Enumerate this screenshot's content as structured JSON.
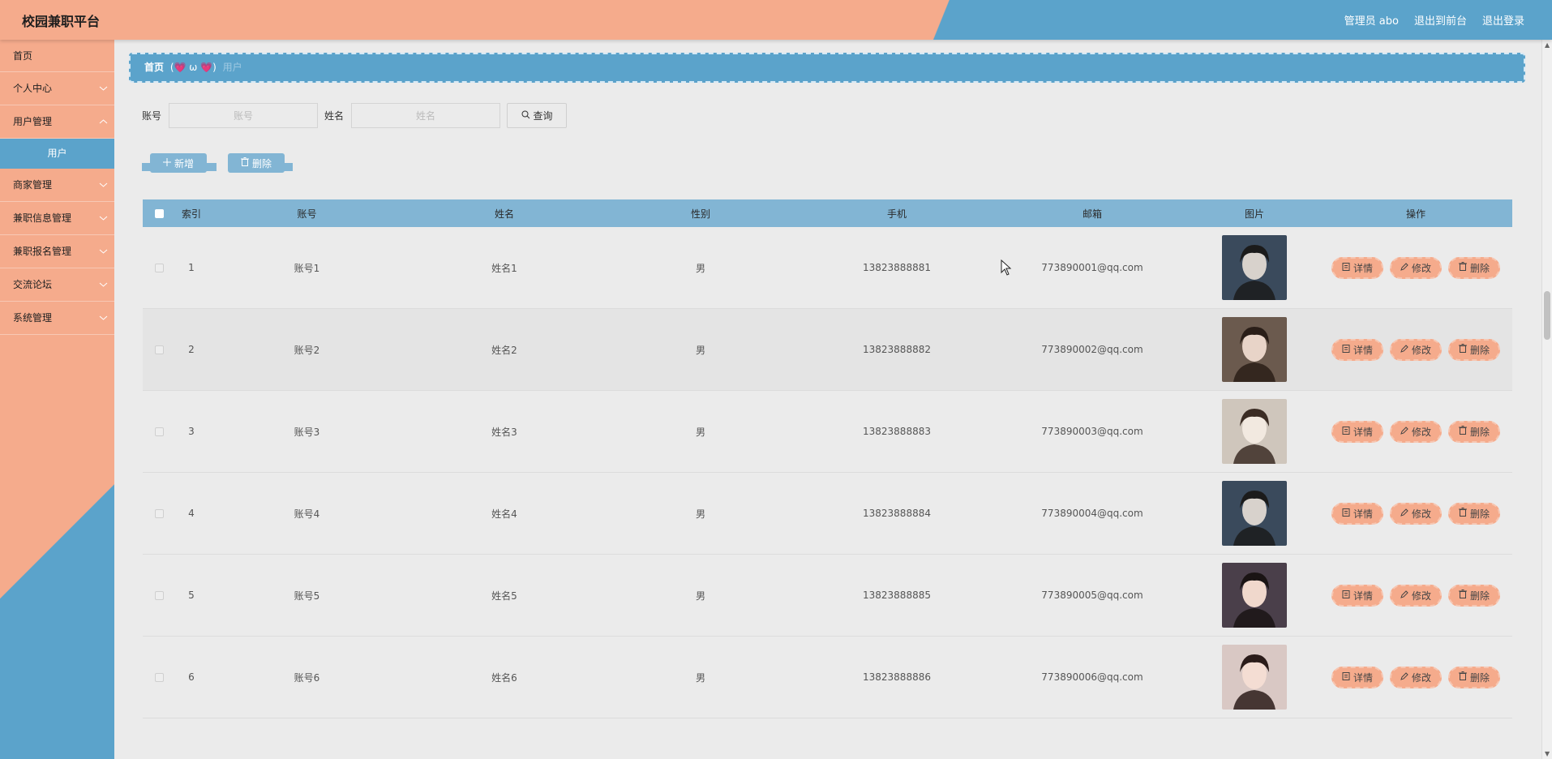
{
  "app": {
    "title": "校园兼职平台"
  },
  "header": {
    "links": [
      "管理员 abo",
      "退出到前台",
      "退出登录"
    ]
  },
  "sidebar": {
    "items": [
      {
        "label": "首页",
        "expandable": false
      },
      {
        "label": "个人中心",
        "expandable": true
      },
      {
        "label": "用户管理",
        "expandable": true
      },
      {
        "label": "商家管理",
        "expandable": true
      },
      {
        "label": "兼职信息管理",
        "expandable": true
      },
      {
        "label": "兼职报名管理",
        "expandable": true
      },
      {
        "label": "交流论坛",
        "expandable": true
      },
      {
        "label": "系统管理",
        "expandable": true
      }
    ],
    "active_submenu": "用户"
  },
  "breadcrumb": {
    "home": "首页",
    "separator": "(💗 ω 💗)",
    "current": "用户"
  },
  "search": {
    "account_label": "账号",
    "account_placeholder": "账号",
    "name_label": "姓名",
    "name_placeholder": "姓名",
    "query_button": "查询"
  },
  "actions": {
    "add": "新增",
    "delete": "删除"
  },
  "table": {
    "headers": [
      "索引",
      "账号",
      "姓名",
      "性别",
      "手机",
      "邮箱",
      "图片",
      "操作"
    ],
    "ops": {
      "detail": "详情",
      "edit": "修改",
      "delete": "删除"
    },
    "rows": [
      {
        "idx": "1",
        "account": "账号1",
        "name": "姓名1",
        "sex": "男",
        "phone": "13823888881",
        "email": "773890001@qq.com"
      },
      {
        "idx": "2",
        "account": "账号2",
        "name": "姓名2",
        "sex": "男",
        "phone": "13823888882",
        "email": "773890002@qq.com"
      },
      {
        "idx": "3",
        "account": "账号3",
        "name": "姓名3",
        "sex": "男",
        "phone": "13823888883",
        "email": "773890003@qq.com"
      },
      {
        "idx": "4",
        "account": "账号4",
        "name": "姓名4",
        "sex": "男",
        "phone": "13823888884",
        "email": "773890004@qq.com"
      },
      {
        "idx": "5",
        "account": "账号5",
        "name": "姓名5",
        "sex": "男",
        "phone": "13823888885",
        "email": "773890005@qq.com"
      },
      {
        "idx": "6",
        "account": "账号6",
        "name": "姓名6",
        "sex": "男",
        "phone": "13823888886",
        "email": "773890006@qq.com"
      }
    ]
  },
  "colors": {
    "peach": "#f5ab8c",
    "blue": "#5ba3cb",
    "table_header": "#82b5d4",
    "background": "#ebebeb"
  }
}
